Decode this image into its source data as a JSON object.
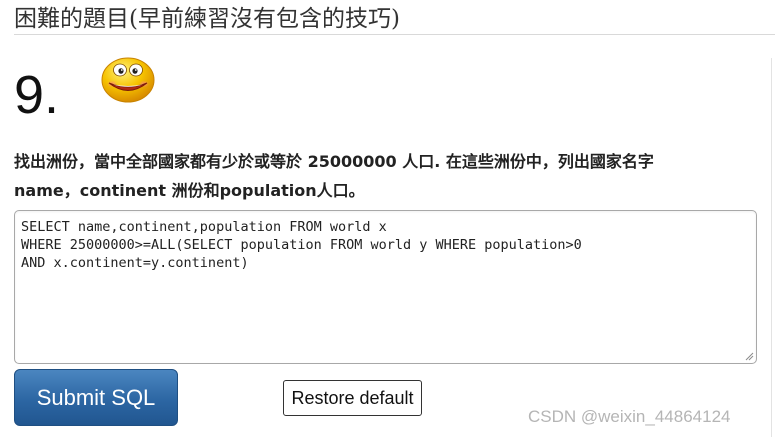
{
  "section": {
    "title": "困難的題目(早前練習沒有包含的技巧)"
  },
  "question": {
    "number": "9.",
    "icon": "smiley-face-icon",
    "text_line1": "找出洲份，當中全部國家都有少於或等於 25000000 人口. 在這些洲份中，列出國家名字",
    "text_line2": "name，continent 洲份和population人口。"
  },
  "editor": {
    "line1": "SELECT name,continent,population FROM world x",
    "line2": "WHERE 25000000>=ALL(SELECT population FROM world y WHERE population>0",
    "line3": "AND x.continent=y.continent)"
  },
  "buttons": {
    "submit_label": "Submit SQL",
    "restore_label": "Restore default"
  },
  "watermark": {
    "text": "CSDN @weixin_44864124"
  },
  "colors": {
    "submit_button": "#2c66a3",
    "smiley_face": "#f4b800",
    "watermark": "#b5b5b5"
  }
}
